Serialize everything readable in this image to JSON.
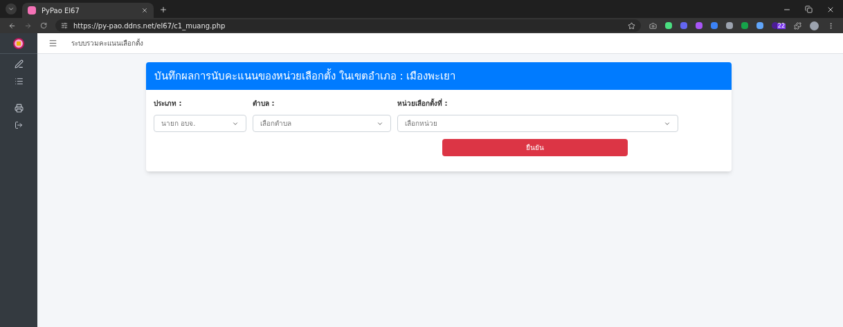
{
  "browser": {
    "tab_title": "PyPao El67",
    "url": "https://py-pao.ddns.net/el67/c1_muang.php",
    "extension_badge": "22"
  },
  "app": {
    "header_title": "ระบบรวมคะแนนเลือกตั้ง"
  },
  "card": {
    "title": "บันทึกผลการนับคะแนนของหน่วยเลือกตั้ง ในเขตอำเภอ : เมืองพะเยา",
    "fields": [
      {
        "label": "ประเภท :",
        "value": "นายก อบจ."
      },
      {
        "label": "ตำบล :",
        "value": "เลือกตำบล"
      },
      {
        "label": "หน่วยเลือกตั้งที่ :",
        "value": "เลือกหน่วย"
      }
    ],
    "button": "ยืนยัน"
  }
}
